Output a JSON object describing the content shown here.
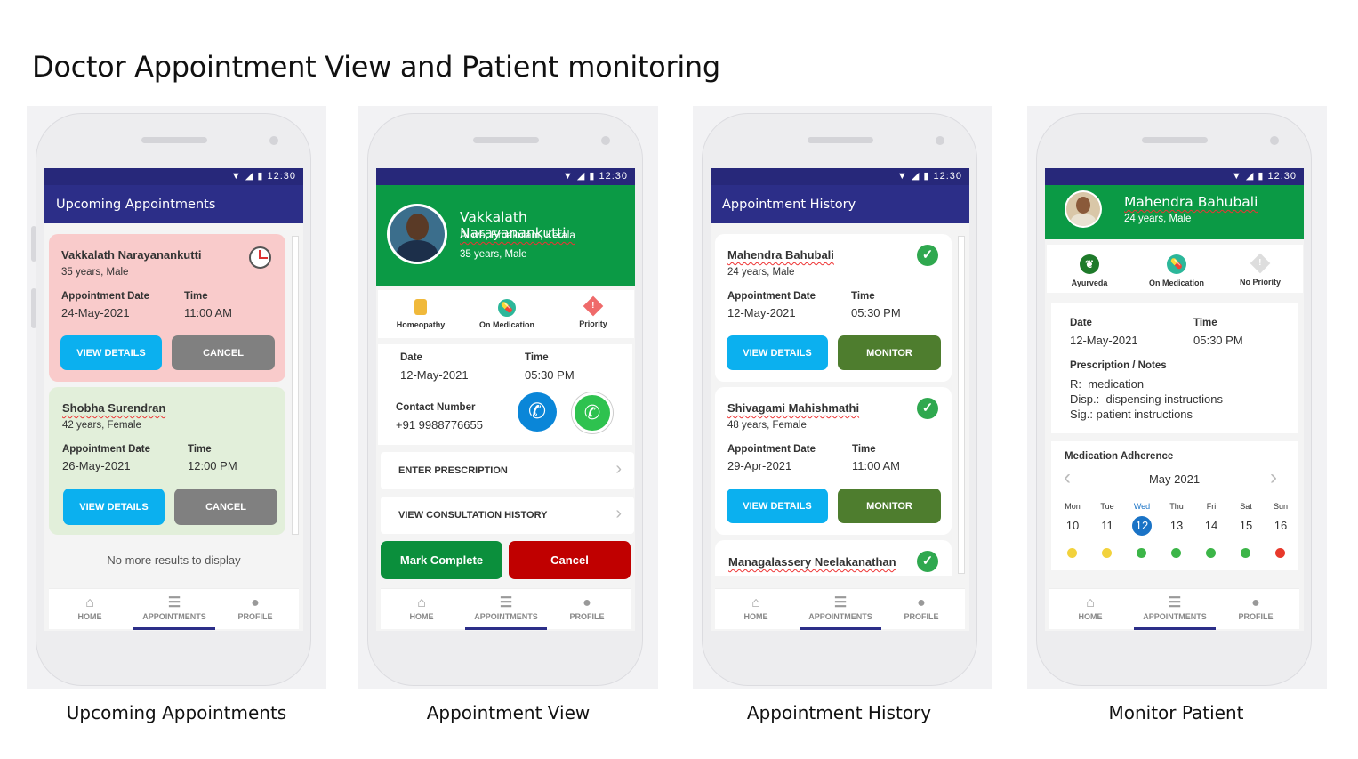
{
  "page_title": "Doctor Appointment View and Patient monitoring",
  "status_time": "12:30",
  "status_icons": "▼ ◢ ▮",
  "nav": {
    "home": "HOME",
    "appointments": "APPOINTMENTS",
    "profile": "PROFILE"
  },
  "captions": [
    "Upcoming Appointments",
    "Appointment View",
    "Appointment History",
    "Monitor Patient"
  ],
  "upcoming": {
    "title": "Upcoming Appointments",
    "appointment_date_label": "Appointment Date",
    "time_label": "Time",
    "cards": [
      {
        "name": "Vakkalath Narayanankutti",
        "sub": "35 years, Male",
        "date": "24-May-2021",
        "time": "11:00 AM",
        "view": "VIEW DETAILS",
        "cancel": "CANCEL"
      },
      {
        "name": "Shobha Surendran",
        "sub": "42 years, Female",
        "date": "26-May-2021",
        "time": "12:00 PM",
        "view": "VIEW DETAILS",
        "cancel": "CANCEL"
      }
    ],
    "no_more": "No more results to display"
  },
  "view": {
    "name": "Vakkalath Narayanankutti",
    "location": "Aluva, Ernakulam, Kerala",
    "sub": "35 years, Male",
    "tags": [
      "Homeopathy",
      "On Medication",
      "Priority"
    ],
    "date_label": "Date",
    "date": "12-May-2021",
    "time_label": "Time",
    "time": "05:30 PM",
    "contact_label": "Contact Number",
    "contact": "+91 9988776655",
    "enter_prescription": "ENTER PRESCRIPTION",
    "view_history": "VIEW CONSULTATION HISTORY",
    "mark_complete": "Mark Complete",
    "cancel": "Cancel"
  },
  "history": {
    "title": "Appointment History",
    "appointment_date_label": "Appointment Date",
    "time_label": "Time",
    "cards": [
      {
        "name": "Mahendra Bahubali",
        "sub": "24 years, Male",
        "date": "12-May-2021",
        "time": "05:30 PM",
        "view": "VIEW DETAILS",
        "monitor": "MONITOR"
      },
      {
        "name": "Shivagami Mahishmathi",
        "sub": "48 years, Female",
        "date": "29-Apr-2021",
        "time": "11:00 AM",
        "view": "VIEW DETAILS",
        "monitor": "MONITOR"
      },
      {
        "name": "Managalassery Neelakanathan"
      }
    ]
  },
  "monitor": {
    "name": "Mahendra Bahubali",
    "sub": "24 years, Male",
    "tags": [
      "Ayurveda",
      "On Medication",
      "No Priority"
    ],
    "date_label": "Date",
    "date": "12-May-2021",
    "time_label": "Time",
    "time": "05:30 PM",
    "notes_label": "Prescription / Notes",
    "rx_label": "R:",
    "rx": "medication",
    "disp_label": "Disp.:",
    "disp": "dispensing instructions",
    "sig_label": "Sig.:",
    "sig": "patient instructions",
    "adherence_label": "Medication Adherence",
    "month": "May 2021",
    "days": [
      {
        "dow": "Mon",
        "num": "10",
        "status": "yellow"
      },
      {
        "dow": "Tue",
        "num": "11",
        "status": "yellow"
      },
      {
        "dow": "Wed",
        "num": "12",
        "status": "green"
      },
      {
        "dow": "Thu",
        "num": "13",
        "status": "green"
      },
      {
        "dow": "Fri",
        "num": "14",
        "status": "green"
      },
      {
        "dow": "Sat",
        "num": "15",
        "status": "green"
      },
      {
        "dow": "Sun",
        "num": "16",
        "status": "red"
      }
    ],
    "selected_day": "12"
  },
  "colors": {
    "appbar": "#2c2e88",
    "green_header": "#0b9a45",
    "view_btn": "#0bb0ef",
    "cancel_grey": "#808080",
    "monitor_btn": "#4e7d2e",
    "mark_complete": "#0b8f3c",
    "cancel_red": "#c00000",
    "pink_card": "#f9cbcb",
    "green_card": "#e2efda"
  }
}
